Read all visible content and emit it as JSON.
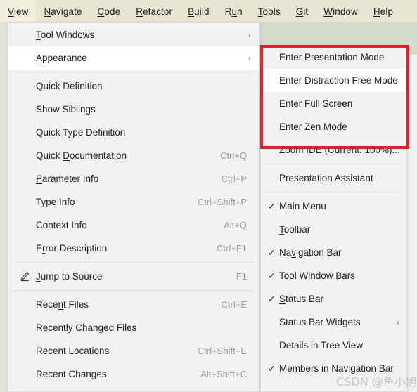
{
  "menubar": {
    "items": [
      {
        "label": "View",
        "mnemonic": "V",
        "selected": true
      },
      {
        "label": "Navigate",
        "mnemonic": "N",
        "selected": false
      },
      {
        "label": "Code",
        "mnemonic": "C",
        "selected": false
      },
      {
        "label": "Refactor",
        "mnemonic": "R",
        "selected": false
      },
      {
        "label": "Build",
        "mnemonic": "B",
        "selected": false
      },
      {
        "label": "Run",
        "mnemonic": "u",
        "selected": false
      },
      {
        "label": "Tools",
        "mnemonic": "T",
        "selected": false
      },
      {
        "label": "Git",
        "mnemonic": "G",
        "selected": false
      },
      {
        "label": "Window",
        "mnemonic": "W",
        "selected": false
      },
      {
        "label": "Help",
        "mnemonic": "H",
        "selected": false
      }
    ]
  },
  "view_menu": {
    "items": [
      {
        "type": "item",
        "label": "Tool Windows",
        "mnemonic": "T",
        "accel": "",
        "submenu": true,
        "hover": false,
        "icon": ""
      },
      {
        "type": "item",
        "label": "Appearance",
        "mnemonic": "A",
        "accel": "",
        "submenu": true,
        "hover": true,
        "icon": ""
      },
      {
        "type": "separator"
      },
      {
        "type": "item",
        "label": "Quick Definition",
        "mnemonic": "k",
        "accel": "",
        "submenu": false,
        "hover": false,
        "icon": ""
      },
      {
        "type": "item",
        "label": "Show Siblings",
        "mnemonic": "",
        "accel": "",
        "submenu": false,
        "hover": false,
        "icon": ""
      },
      {
        "type": "item",
        "label": "Quick Type Definition",
        "mnemonic": "",
        "accel": "",
        "submenu": false,
        "hover": false,
        "icon": ""
      },
      {
        "type": "item",
        "label": "Quick Documentation",
        "mnemonic": "D",
        "accel": "Ctrl+Q",
        "submenu": false,
        "hover": false,
        "icon": ""
      },
      {
        "type": "item",
        "label": "Parameter Info",
        "mnemonic": "P",
        "accel": "Ctrl+P",
        "submenu": false,
        "hover": false,
        "icon": ""
      },
      {
        "type": "item",
        "label": "Type Info",
        "mnemonic": "e",
        "accel": "Ctrl+Shift+P",
        "submenu": false,
        "hover": false,
        "icon": ""
      },
      {
        "type": "item",
        "label": "Context Info",
        "mnemonic": "C",
        "accel": "Alt+Q",
        "submenu": false,
        "hover": false,
        "icon": ""
      },
      {
        "type": "item",
        "label": "Error Description",
        "mnemonic": "r",
        "accel": "Ctrl+F1",
        "submenu": false,
        "hover": false,
        "icon": ""
      },
      {
        "type": "separator"
      },
      {
        "type": "item",
        "label": "Jump to Source",
        "mnemonic": "J",
        "accel": "F1",
        "submenu": false,
        "hover": false,
        "icon": "pencil-icon"
      },
      {
        "type": "separator"
      },
      {
        "type": "item",
        "label": "Recent Files",
        "mnemonic": "n",
        "accel": "Ctrl+E",
        "submenu": false,
        "hover": false,
        "icon": ""
      },
      {
        "type": "item",
        "label": "Recently Changed Files",
        "mnemonic": "",
        "accel": "",
        "submenu": false,
        "hover": false,
        "icon": ""
      },
      {
        "type": "item",
        "label": "Recent Locations",
        "mnemonic": "",
        "accel": "Ctrl+Shift+E",
        "submenu": false,
        "hover": false,
        "icon": ""
      },
      {
        "type": "item",
        "label": "Recent Changes",
        "mnemonic": "e",
        "accel": "Alt+Shift+C",
        "submenu": false,
        "hover": false,
        "icon": ""
      },
      {
        "type": "separator"
      }
    ]
  },
  "appearance_menu": {
    "items": [
      {
        "type": "item",
        "label": "Enter Presentation Mode",
        "mnemonic": "",
        "checked": false,
        "submenu": false,
        "hover": false
      },
      {
        "type": "item",
        "label": "Enter Distraction Free Mode",
        "mnemonic": "",
        "checked": false,
        "submenu": false,
        "hover": true
      },
      {
        "type": "item",
        "label": "Enter Full Screen",
        "mnemonic": "",
        "checked": false,
        "submenu": false,
        "hover": false
      },
      {
        "type": "item",
        "label": "Enter Zen Mode",
        "mnemonic": "",
        "checked": false,
        "submenu": false,
        "hover": false
      },
      {
        "type": "item",
        "label": "Zoom IDE (Current: 100%)...",
        "mnemonic": "",
        "checked": false,
        "submenu": false,
        "hover": false
      },
      {
        "type": "separator"
      },
      {
        "type": "item",
        "label": "Presentation Assistant",
        "mnemonic": "",
        "checked": false,
        "submenu": false,
        "hover": false
      },
      {
        "type": "separator"
      },
      {
        "type": "item",
        "label": "Main Menu",
        "mnemonic": "",
        "checked": true,
        "submenu": false,
        "hover": false
      },
      {
        "type": "item",
        "label": "Toolbar",
        "mnemonic": "T",
        "checked": false,
        "submenu": false,
        "hover": false
      },
      {
        "type": "item",
        "label": "Navigation Bar",
        "mnemonic": "v",
        "checked": true,
        "submenu": false,
        "hover": false
      },
      {
        "type": "item",
        "label": "Tool Window Bars",
        "mnemonic": "",
        "checked": true,
        "submenu": false,
        "hover": false
      },
      {
        "type": "item",
        "label": "Status Bar",
        "mnemonic": "S",
        "checked": true,
        "submenu": false,
        "hover": false
      },
      {
        "type": "item",
        "label": "Status Bar Widgets",
        "mnemonic": "W",
        "checked": false,
        "submenu": true,
        "hover": false
      },
      {
        "type": "item",
        "label": "Details in Tree View",
        "mnemonic": "",
        "checked": false,
        "submenu": false,
        "hover": false
      },
      {
        "type": "item",
        "label": "Members in Navigation Bar",
        "mnemonic": "",
        "checked": true,
        "submenu": false,
        "hover": false
      }
    ]
  },
  "annotation": {
    "red_box_color": "#ed1c24"
  },
  "watermark": {
    "text": "CSDN @鱼小旭"
  },
  "colors": {
    "menubar_bg": "#e8e6d2",
    "menubar_selected_bg": "#f2f0dc",
    "popup_bg": "#f2f2f2",
    "hover_bg": "#ffffff",
    "editor_bg": "#d4ddc9",
    "accel_text": "#9b9b9b"
  }
}
